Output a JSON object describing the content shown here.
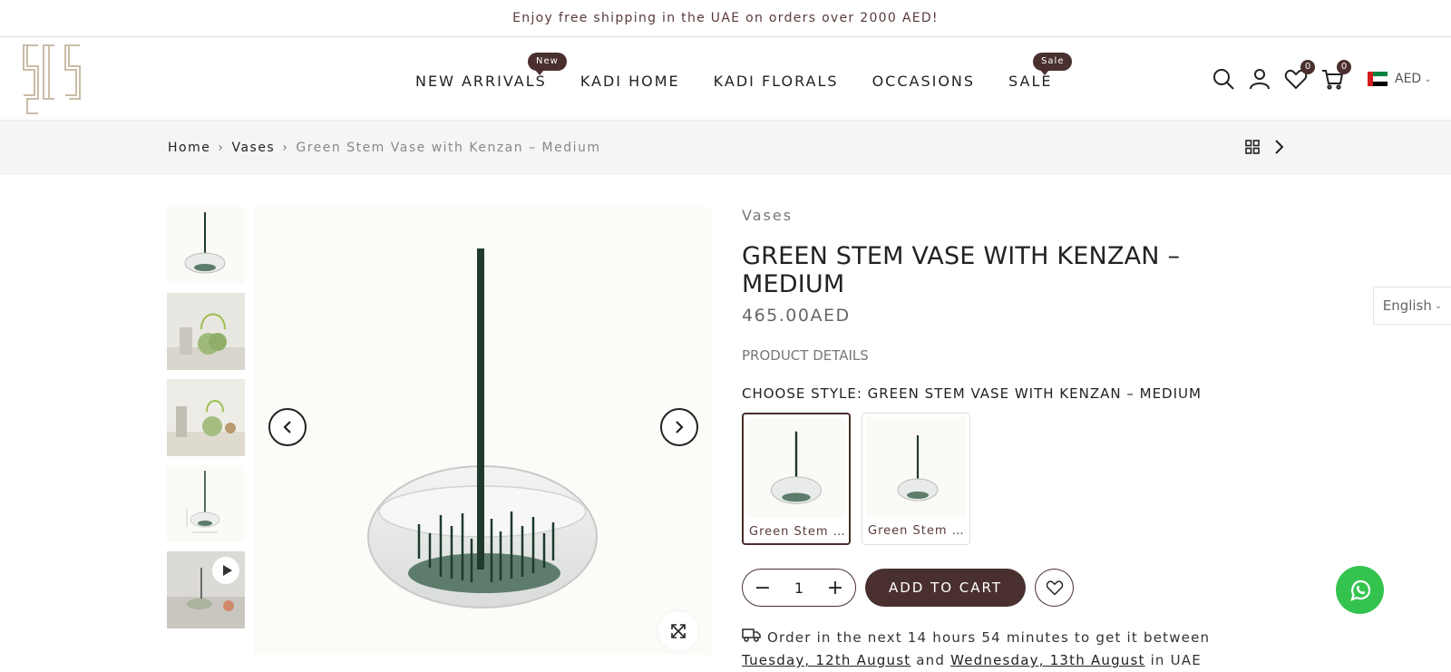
{
  "announcement": "Enjoy free shipping in the UAE on orders over 2000 AED!",
  "header": {
    "nav": [
      {
        "label": "NEW ARRIVALS",
        "badge": "New"
      },
      {
        "label": "KADI HOME",
        "badge": ""
      },
      {
        "label": "KADI FLORALS",
        "badge": ""
      },
      {
        "label": "OCCASIONS",
        "badge": ""
      },
      {
        "label": "SALE",
        "badge": "Sale"
      }
    ],
    "wishlist_count": "0",
    "cart_count": "0",
    "currency": "AED"
  },
  "breadcrumb": {
    "home": "Home",
    "category": "Vases",
    "current": "Green Stem Vase with Kenzan – Medium"
  },
  "product": {
    "category": "Vases",
    "title": "GREEN STEM VASE WITH KENZAN – MEDIUM",
    "price": "465.00AED",
    "details_label": "PRODUCT DETAILS",
    "style_label": "CHOOSE STYLE: GREEN STEM VASE WITH KENZAN – MEDIUM",
    "styles": [
      "Green Stem Vase with Kenzan – Medium",
      "Green Stem Vase with Kenzan – Small"
    ],
    "quantity": "1",
    "add_to_cart": "ADD TO CART"
  },
  "delivery": {
    "prefix": "Order in the next 14 hours 54 minutes to get it between",
    "date1": "Tuesday, 12th August",
    "and": "and",
    "date2": "Wednesday, 13th August",
    "suffix": "in UAE"
  },
  "language": "English",
  "colors": {
    "accent": "#4a2f2f",
    "stem": "#1f3a2c",
    "kenzan": "#5d7c6c",
    "whatsapp": "#35c34f"
  }
}
